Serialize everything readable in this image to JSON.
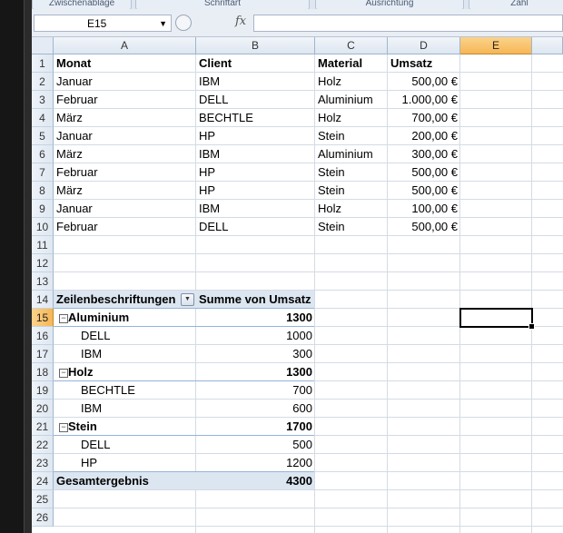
{
  "ribbon": {
    "groups": [
      "Zwischenablage",
      "Schriftart",
      "Ausrichtung",
      "Zahl"
    ]
  },
  "name_box": "E15",
  "formula_icon": "fx",
  "columns": [
    "A",
    "B",
    "C",
    "D",
    "E"
  ],
  "rows": [
    "1",
    "2",
    "3",
    "4",
    "5",
    "6",
    "7",
    "8",
    "9",
    "10",
    "11",
    "12",
    "13",
    "14",
    "15",
    "16",
    "17",
    "18",
    "19",
    "20",
    "21",
    "22",
    "23",
    "24",
    "25",
    "26"
  ],
  "table": {
    "headers": [
      "Monat",
      "Client",
      "Material",
      "Umsatz"
    ],
    "rows": [
      [
        "Januar",
        "IBM",
        "Holz",
        "500,00 €"
      ],
      [
        "Februar",
        "DELL",
        "Aluminium",
        "1.000,00 €"
      ],
      [
        "März",
        "BECHTLE",
        "Holz",
        "700,00 €"
      ],
      [
        "Januar",
        "HP",
        "Stein",
        "200,00 €"
      ],
      [
        "März",
        "IBM",
        "Aluminium",
        "300,00 €"
      ],
      [
        "Februar",
        "HP",
        "Stein",
        "500,00 €"
      ],
      [
        "März",
        "HP",
        "Stein",
        "500,00 €"
      ],
      [
        "Januar",
        "IBM",
        "Holz",
        "100,00 €"
      ],
      [
        "Februar",
        "DELL",
        "Stein",
        "500,00 €"
      ]
    ]
  },
  "pivot": {
    "header_label": "Zeilenbeschriftungen",
    "header_value": "Summe von Umsatz",
    "groups": [
      {
        "name": "Aluminium",
        "total": "1300",
        "items": [
          [
            "DELL",
            "1000"
          ],
          [
            "IBM",
            "300"
          ]
        ]
      },
      {
        "name": "Holz",
        "total": "1300",
        "items": [
          [
            "BECHTLE",
            "700"
          ],
          [
            "IBM",
            "600"
          ]
        ]
      },
      {
        "name": "Stein",
        "total": "1700",
        "items": [
          [
            "DELL",
            "500"
          ],
          [
            "HP",
            "1200"
          ]
        ]
      }
    ],
    "grand_total_label": "Gesamtergebnis",
    "grand_total_value": "4300",
    "collapse_glyph": "−"
  },
  "selected_cell": "E15"
}
